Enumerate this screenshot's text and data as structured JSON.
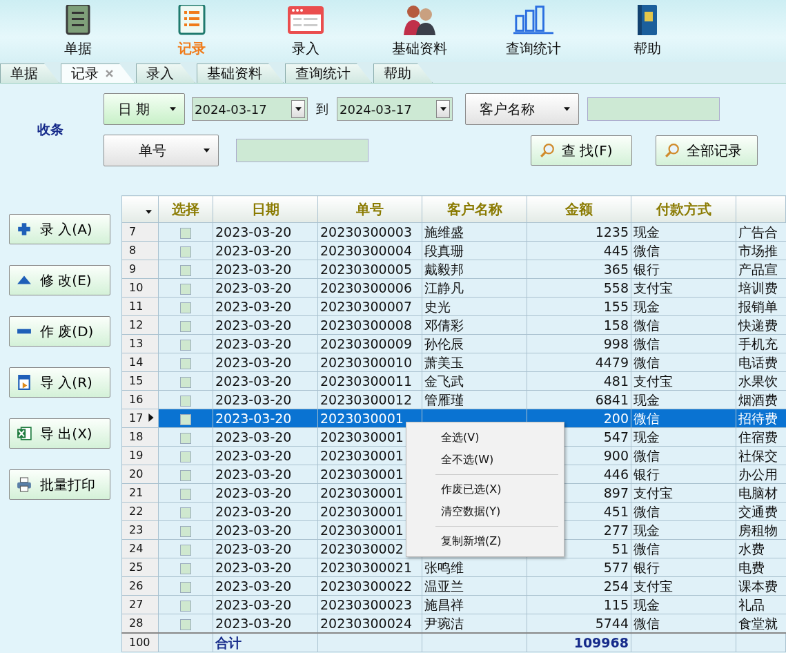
{
  "toolbar": [
    {
      "label": "单据",
      "kind": "ledger",
      "selected": false
    },
    {
      "label": "记录",
      "kind": "list",
      "selected": true
    },
    {
      "label": "录入",
      "kind": "form",
      "selected": false
    },
    {
      "label": "基础资料",
      "kind": "people",
      "selected": false
    },
    {
      "label": "查询统计",
      "kind": "chart",
      "selected": false
    },
    {
      "label": "帮助",
      "kind": "book",
      "selected": false
    }
  ],
  "tabs": [
    {
      "label": "单据",
      "selected": false,
      "closable": false
    },
    {
      "label": "记录",
      "selected": true,
      "closable": true
    },
    {
      "label": "录入",
      "selected": false,
      "closable": false
    },
    {
      "label": "基础资料",
      "selected": false,
      "closable": false
    },
    {
      "label": "查询统计",
      "selected": false,
      "closable": false
    },
    {
      "label": "帮助",
      "selected": false,
      "closable": false
    }
  ],
  "filter": {
    "title": "收条",
    "date_dropdown": "日 期",
    "date_from": "2024-03-17",
    "to_label": "到",
    "date_to": "2024-03-17",
    "customer_dropdown": "客户名称",
    "number_dropdown": "单号",
    "search_button": "查 找(F)",
    "all_button": "全部记录"
  },
  "actions": [
    {
      "label": "录 入(A)",
      "kind": "plus"
    },
    {
      "label": "修 改(E)",
      "kind": "up"
    },
    {
      "label": "作 废(D)",
      "kind": "minus"
    },
    {
      "label": "导 入(R)",
      "kind": "import"
    },
    {
      "label": "导 出(X)",
      "kind": "excel"
    },
    {
      "label": "批量打印",
      "kind": "print"
    }
  ],
  "table": {
    "columns": [
      "选择",
      "日期",
      "单号",
      "客户名称",
      "金额",
      "付款方式"
    ],
    "rows": [
      {
        "index": "7",
        "checked": false,
        "selected": false,
        "date": "2023-03-20",
        "number": "20230300003",
        "customer": "施维盛",
        "amount": "1235",
        "payment": "现金",
        "column_8": "广告合"
      },
      {
        "index": "8",
        "checked": false,
        "selected": false,
        "date": "2023-03-20",
        "number": "20230300004",
        "customer": "段真珊",
        "amount": "445",
        "payment": "微信",
        "column_8": "市场推"
      },
      {
        "index": "9",
        "checked": false,
        "selected": false,
        "date": "2023-03-20",
        "number": "20230300005",
        "customer": "戴毅邦",
        "amount": "365",
        "payment": "银行",
        "column_8": "产品宣"
      },
      {
        "index": "10",
        "checked": false,
        "selected": false,
        "date": "2023-03-20",
        "number": "20230300006",
        "customer": "江静凡",
        "amount": "558",
        "payment": "支付宝",
        "column_8": "培训费"
      },
      {
        "index": "11",
        "checked": false,
        "selected": false,
        "date": "2023-03-20",
        "number": "20230300007",
        "customer": "史光",
        "amount": "155",
        "payment": "现金",
        "column_8": "报销单"
      },
      {
        "index": "12",
        "checked": false,
        "selected": false,
        "date": "2023-03-20",
        "number": "20230300008",
        "customer": "邓倩彩",
        "amount": "158",
        "payment": "微信",
        "column_8": "快递费"
      },
      {
        "index": "13",
        "checked": false,
        "selected": false,
        "date": "2023-03-20",
        "number": "20230300009",
        "customer": "孙伦辰",
        "amount": "998",
        "payment": "微信",
        "column_8": "手机充"
      },
      {
        "index": "14",
        "checked": false,
        "selected": false,
        "date": "2023-03-20",
        "number": "20230300010",
        "customer": "萧美玉",
        "amount": "4479",
        "payment": "微信",
        "column_8": "电话费"
      },
      {
        "index": "15",
        "checked": false,
        "selected": false,
        "date": "2023-03-20",
        "number": "20230300011",
        "customer": "金飞武",
        "amount": "481",
        "payment": "支付宝",
        "column_8": "水果饮"
      },
      {
        "index": "16",
        "checked": false,
        "selected": false,
        "date": "2023-03-20",
        "number": "20230300012",
        "customer": "管雁瑾",
        "amount": "6841",
        "payment": "现金",
        "column_8": "烟酒费"
      },
      {
        "index": "17",
        "checked": false,
        "selected": true,
        "date": "2023-03-20",
        "number": "2023030001",
        "amount": "200",
        "payment": "微信",
        "column_8": "招待费"
      },
      {
        "index": "18",
        "checked": false,
        "selected": false,
        "date": "2023-03-20",
        "number": "2023030001",
        "amount": "547",
        "payment": "现金",
        "column_8": "住宿费"
      },
      {
        "index": "19",
        "checked": false,
        "selected": false,
        "date": "2023-03-20",
        "number": "2023030001",
        "amount": "900",
        "payment": "微信",
        "column_8": "社保交"
      },
      {
        "index": "20",
        "checked": false,
        "selected": false,
        "date": "2023-03-20",
        "number": "2023030001",
        "amount": "446",
        "payment": "银行",
        "column_8": "办公用"
      },
      {
        "index": "21",
        "checked": false,
        "selected": false,
        "date": "2023-03-20",
        "number": "2023030001",
        "amount": "897",
        "payment": "支付宝",
        "column_8": "电脑材"
      },
      {
        "index": "22",
        "checked": false,
        "selected": false,
        "date": "2023-03-20",
        "number": "2023030001",
        "amount": "451",
        "payment": "微信",
        "column_8": "交通费"
      },
      {
        "index": "23",
        "checked": false,
        "selected": false,
        "date": "2023-03-20",
        "number": "2023030001",
        "amount": "277",
        "payment": "现金",
        "column_8": "房租物"
      },
      {
        "index": "24",
        "checked": false,
        "selected": false,
        "date": "2023-03-20",
        "number": "2023030002",
        "amount": "51",
        "payment": "微信",
        "column_8": "水费"
      },
      {
        "index": "25",
        "checked": false,
        "selected": false,
        "date": "2023-03-20",
        "number": "20230300021",
        "customer": "张鸣维",
        "amount": "577",
        "payment": "银行",
        "column_8": "电费"
      },
      {
        "index": "26",
        "checked": false,
        "selected": false,
        "date": "2023-03-20",
        "number": "20230300022",
        "customer": "温亚兰",
        "amount": "254",
        "payment": "支付宝",
        "column_8": "课本费"
      },
      {
        "index": "27",
        "checked": false,
        "selected": false,
        "date": "2023-03-20",
        "number": "20230300023",
        "customer": "施昌祥",
        "amount": "115",
        "payment": "现金",
        "column_8": "礼品"
      },
      {
        "index": "28",
        "checked": false,
        "selected": false,
        "date": "2023-03-20",
        "number": "20230300024",
        "customer": "尹琬洁",
        "amount": "5744",
        "payment": "微信",
        "column_8": "食堂就"
      }
    ],
    "footer": {
      "index": "100",
      "label": "合计",
      "amount": "109968"
    }
  },
  "context_menu": {
    "groups": [
      [
        "全选(V)",
        "全不选(W)"
      ],
      [
        "作废已选(X)",
        "清空数据(Y)"
      ],
      [
        "复制新增(Z)"
      ]
    ]
  }
}
